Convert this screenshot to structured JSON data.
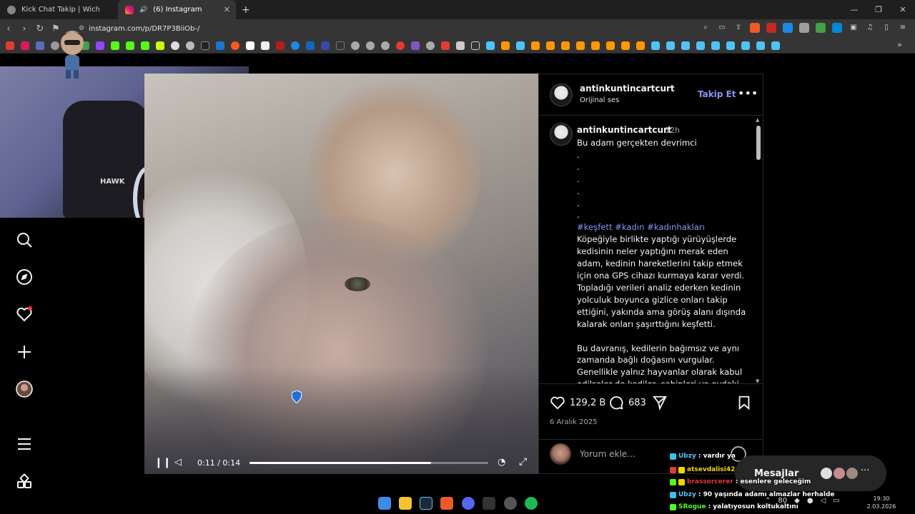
{
  "browser": {
    "tabs": [
      {
        "label": "Kick Chat Takip | Wich",
        "active": false
      },
      {
        "label": "(6) Instagram",
        "active": true
      }
    ],
    "url": "instagram.com/p/DR7P3BiiOb-/"
  },
  "post": {
    "author": "antinkuntincartcurt",
    "audio": "Orijinal ses",
    "follow_label": "Takip Et",
    "caption_time": "12h",
    "caption_first": "Bu adam gerçekten devrimci",
    "caption_dots": [
      ".",
      ".",
      ".",
      ".",
      ".",
      "."
    ],
    "hashtags": "#keşfett #kadın #kadınhakları",
    "paragraph1": "Köpeğiyle birlikte yaptığı yürüyüşlerde kedisinin neler yaptığını merak eden adam, kedinin hareketlerini takip etmek için ona GPS cihazı kurmaya karar verdi. Topladığı verileri analiz ederken kedinin yolculuk boyunca gizlice onları takip ettiğini, yakında ama görüş alanı dışında kalarak onları şaşırttığını keşfetti.",
    "paragraph2": "Bu davranış, kedilerin bağımsız ve aynı zamanda bağlı doğasını vurgular. Genellikle yalnız hayvanlar olarak kabul edilseler de kediler, sahipleri ve evdeki",
    "likes": "129,2 B",
    "comments": "683",
    "date": "6 Aralık 2025",
    "comment_placeholder": "Yorum ekle..."
  },
  "video": {
    "time": "0:11 / 0:14",
    "progress": 0.76
  },
  "messages": {
    "label": "Mesajlar"
  },
  "chat": [
    {
      "user": "Ubzy",
      "text": ": vardır ya",
      "color": "#4fc3f7",
      "badge": "#3cc0e8"
    },
    {
      "user": "atsevdalisi42",
      "text": "",
      "color": "#f5d400",
      "badge": "#e53935"
    },
    {
      "user": "brassorcerer",
      "text": ": esenlere geleceğim",
      "color": "#e53935",
      "badge": "#53fc18"
    },
    {
      "user": "Ubzy",
      "text": ": 90 yaşında adamı almazlar herhalde",
      "color": "#4fc3f7",
      "badge": "#3cc0e8"
    },
    {
      "user": "SRogue",
      "text": ": yalatıyosun koltukaltını",
      "color": "#53fc18",
      "badge": "#53fc18"
    }
  ],
  "taskbar": {
    "time": "19:30",
    "date": "2.03.2026",
    "volume_label": "80"
  },
  "webcam": {
    "chair_brand": "HAWK"
  }
}
